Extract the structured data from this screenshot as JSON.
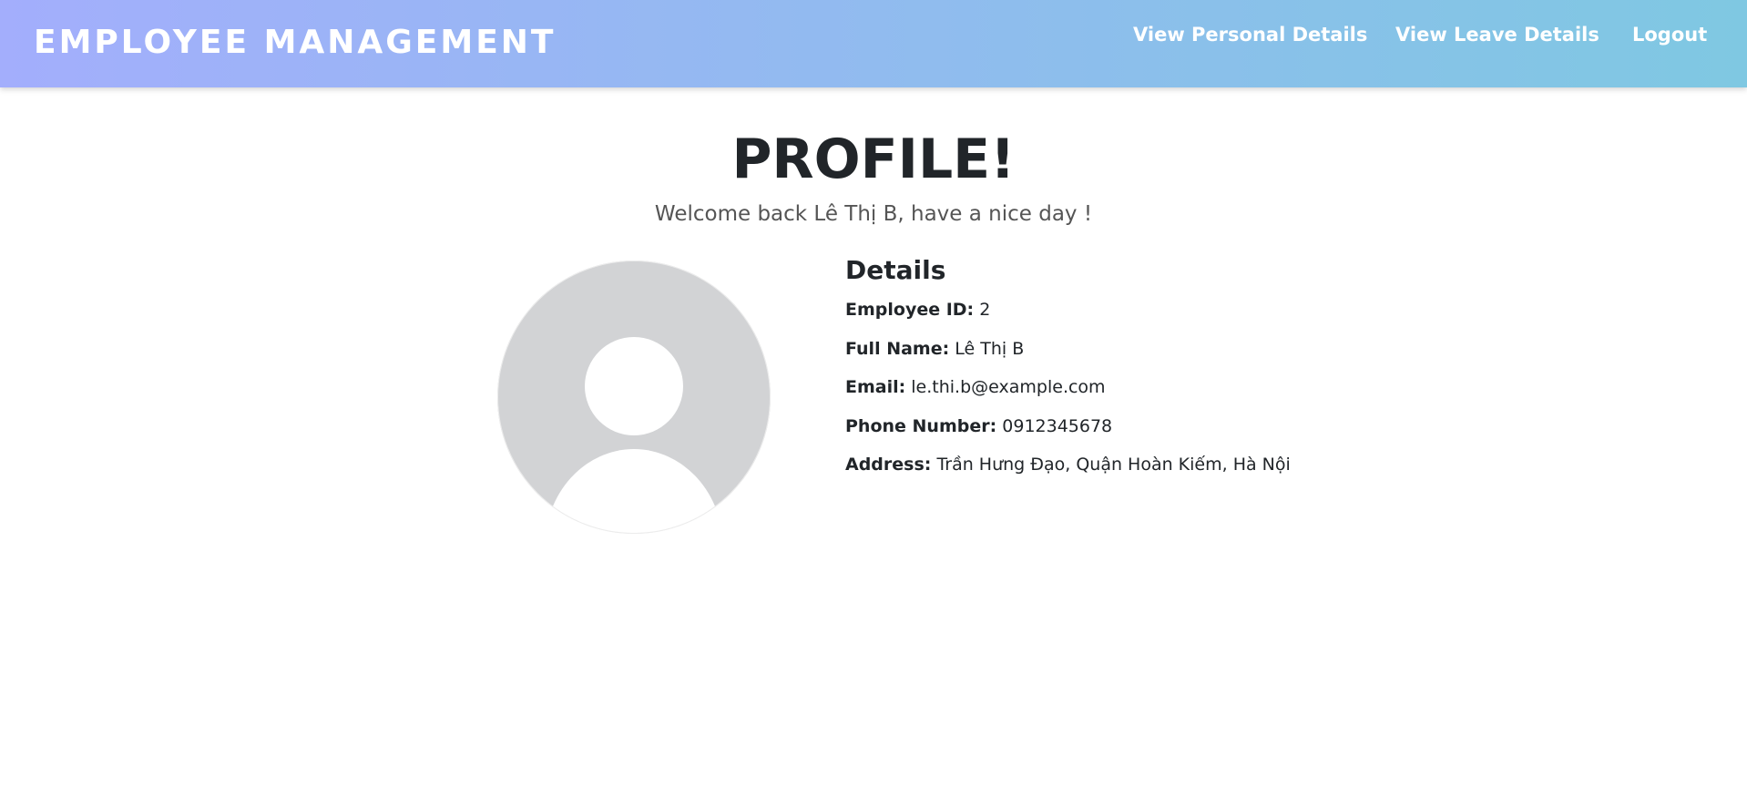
{
  "navbar": {
    "brand": "EMPLOYEE MANAGEMENT",
    "links": {
      "personal": "View Personal Details",
      "leave": "View Leave Details",
      "logout": "Logout"
    },
    "gradient_start": "#a3aefc",
    "gradient_end": "#7fc8e2"
  },
  "main": {
    "title": "PROFILE!",
    "welcome": "Welcome back Lê Thị B, have a nice day !",
    "avatar_icon": "user-avatar-icon",
    "details": {
      "heading": "Details",
      "employee_id": {
        "label": "Employee ID:",
        "value": "2"
      },
      "full_name": {
        "label": "Full Name:",
        "value": "Lê Thị B"
      },
      "email": {
        "label": "Email:",
        "value": "le.thi.b@example.com"
      },
      "phone": {
        "label": "Phone Number:",
        "value": "0912345678"
      },
      "address": {
        "label": "Address:",
        "value": "Trần Hưng Đạo, Quận Hoàn Kiếm, Hà Nội"
      }
    }
  }
}
